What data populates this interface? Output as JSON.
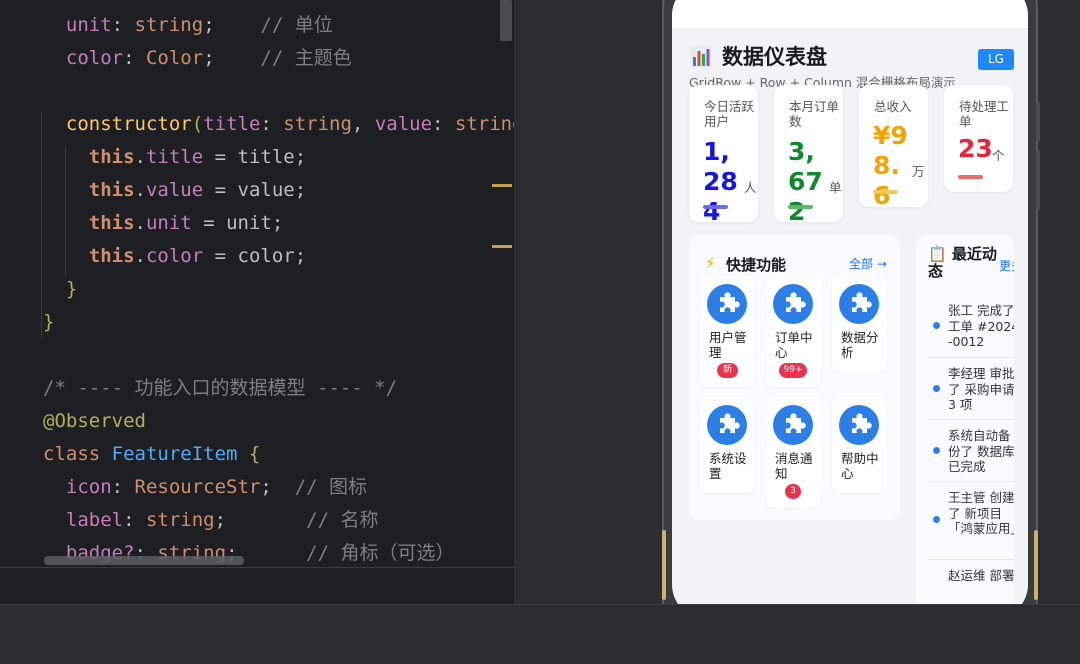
{
  "code": {
    "lines": [
      {
        "parts": [
          {
            "t": "  "
          },
          {
            "t": "unit",
            "c": "prop"
          },
          {
            "t": ": "
          },
          {
            "t": "string",
            "c": "kw"
          },
          {
            "t": ";    "
          },
          {
            "t": "// 单位",
            "c": "com"
          }
        ]
      },
      {
        "parts": [
          {
            "t": "  "
          },
          {
            "t": "color",
            "c": "prop"
          },
          {
            "t": ": "
          },
          {
            "t": "Color",
            "c": "kw"
          },
          {
            "t": ";    "
          },
          {
            "t": "// 主题色",
            "c": "com"
          }
        ]
      },
      {
        "parts": [
          {
            "t": ""
          }
        ]
      },
      {
        "parts": [
          {
            "t": "  "
          },
          {
            "t": "constructor",
            "c": "fn"
          },
          {
            "t": "(",
            "c": "ann"
          },
          {
            "t": "title",
            "c": "prop"
          },
          {
            "t": ": "
          },
          {
            "t": "string",
            "c": "kw"
          },
          {
            "t": ", "
          },
          {
            "t": "value",
            "c": "prop"
          },
          {
            "t": ": "
          },
          {
            "t": "string",
            "c": "kw"
          }
        ]
      },
      {
        "parts": [
          {
            "t": "    "
          },
          {
            "t": "this",
            "c": "this"
          },
          {
            "t": "."
          },
          {
            "t": "title",
            "c": "prop"
          },
          {
            "t": " = title;"
          }
        ]
      },
      {
        "parts": [
          {
            "t": "    "
          },
          {
            "t": "this",
            "c": "this"
          },
          {
            "t": "."
          },
          {
            "t": "value",
            "c": "prop"
          },
          {
            "t": " = value;"
          }
        ]
      },
      {
        "parts": [
          {
            "t": "    "
          },
          {
            "t": "this",
            "c": "this"
          },
          {
            "t": "."
          },
          {
            "t": "unit",
            "c": "prop"
          },
          {
            "t": " = unit;"
          }
        ]
      },
      {
        "parts": [
          {
            "t": "    "
          },
          {
            "t": "this",
            "c": "this"
          },
          {
            "t": "."
          },
          {
            "t": "color",
            "c": "prop"
          },
          {
            "t": " = color;"
          }
        ]
      },
      {
        "parts": [
          {
            "t": "  "
          },
          {
            "t": "}",
            "c": "ann"
          }
        ]
      },
      {
        "parts": [
          {
            "t": "}",
            "c": "ann"
          }
        ]
      },
      {
        "parts": [
          {
            "t": ""
          }
        ]
      },
      {
        "parts": [
          {
            "t": "/* ---- 功能入口的数据模型 ---- */",
            "c": "com"
          }
        ]
      },
      {
        "parts": [
          {
            "t": "@Observed",
            "c": "ann"
          }
        ]
      },
      {
        "parts": [
          {
            "t": "class ",
            "c": "kw"
          },
          {
            "t": "FeatureItem",
            "c": "cls"
          },
          {
            "t": " {",
            "c": "ann"
          }
        ]
      },
      {
        "parts": [
          {
            "t": "  "
          },
          {
            "t": "icon",
            "c": "prop"
          },
          {
            "t": ": "
          },
          {
            "t": "ResourceStr",
            "c": "kw"
          },
          {
            "t": ";  "
          },
          {
            "t": "// 图标",
            "c": "com"
          }
        ]
      },
      {
        "parts": [
          {
            "t": "  "
          },
          {
            "t": "label",
            "c": "prop"
          },
          {
            "t": ": "
          },
          {
            "t": "string",
            "c": "kw"
          },
          {
            "t": ";       "
          },
          {
            "t": "// 名称",
            "c": "com"
          }
        ]
      },
      {
        "parts": [
          {
            "t": "  "
          },
          {
            "t": "badge?",
            "c": "prop"
          },
          {
            "t": ": "
          },
          {
            "t": "string",
            "c": "kw"
          },
          {
            "t": ";      "
          },
          {
            "t": "// 角标（可选）",
            "c": "com"
          }
        ]
      }
    ]
  },
  "app": {
    "title": "数据仪表盘",
    "subtitle": "GridRow + Row + Column 混合栅格布局演示",
    "badge": "LG",
    "stats": [
      {
        "label": "今日活跃用户",
        "value": "1,284",
        "unit": "人",
        "color": "#1515e8",
        "bar": "#6b6bea"
      },
      {
        "label": "本月订单数",
        "value": "3,672",
        "unit": "单",
        "color": "#0f8a2a",
        "bar": "#5cba6e"
      },
      {
        "label": "总收入",
        "value": "¥98.6",
        "unit": "万",
        "color": "#f5a300",
        "bar": "#f7c75a"
      },
      {
        "label": "待处理工单",
        "value": "23",
        "unit": "个",
        "color": "#e8243c",
        "bar": "#ec6a6a"
      }
    ],
    "quick": {
      "icon": "⚡",
      "title": "快捷功能",
      "all": "全部 →",
      "items": [
        {
          "label": "用户管理",
          "badge": "新"
        },
        {
          "label": "订单中心",
          "badge": "99+"
        },
        {
          "label": "数据分析",
          "badge": null
        },
        {
          "label": "系统设置",
          "badge": null
        },
        {
          "label": "消息通知",
          "badge": "3"
        },
        {
          "label": "帮助中心",
          "badge": null
        }
      ]
    },
    "recent": {
      "title": "📋 最近动态",
      "more": "更多 →",
      "items": [
        "张工 完成了 工单 #2024-0012",
        "李经理 审批了 采购申请 3 项",
        "系统自动备份了 数据库 已完成",
        "王主管 创建了 新项目「鸿蒙应用」",
        "赵运维 部署"
      ]
    }
  }
}
